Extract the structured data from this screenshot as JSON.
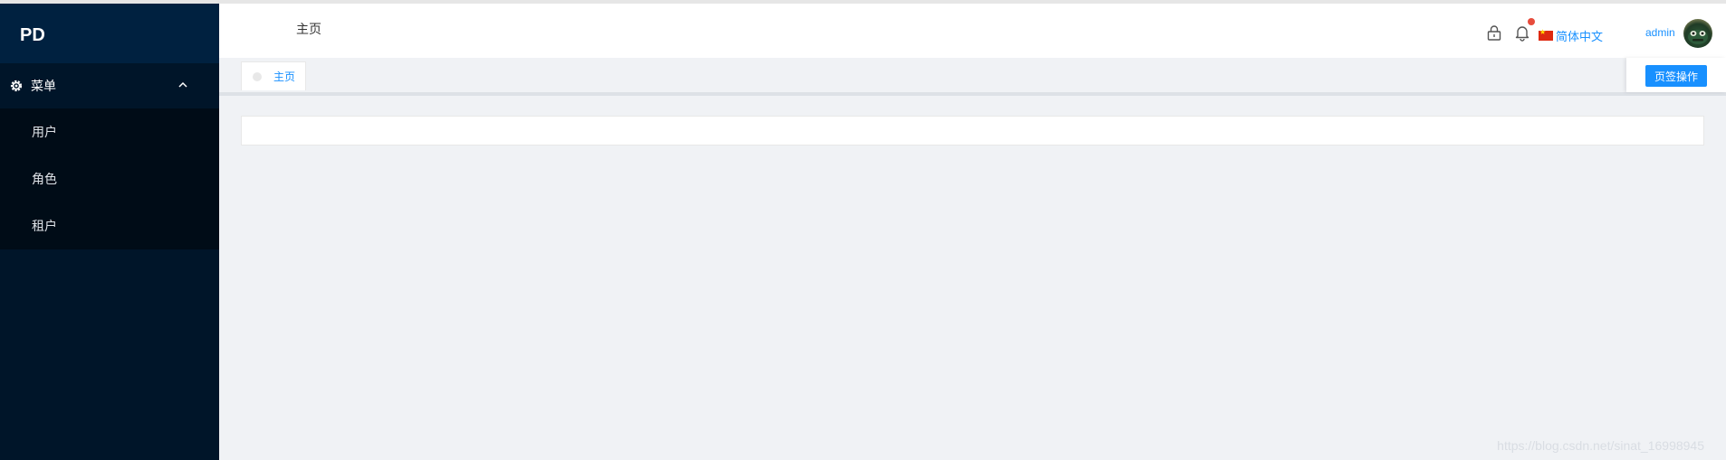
{
  "app": {
    "logo": "PD"
  },
  "sidebar": {
    "group": {
      "label": "菜单",
      "icon": "gear-icon",
      "expanded": true
    },
    "items": [
      {
        "label": "用户"
      },
      {
        "label": "角色"
      },
      {
        "label": "租户"
      }
    ]
  },
  "header": {
    "title": "主页",
    "language": "简体中文",
    "username": "admin",
    "has_notification": true
  },
  "tabs": {
    "items": [
      {
        "label": "主页",
        "active": true
      }
    ],
    "actions_label": "页签操作"
  },
  "watermark": "https://blog.csdn.net/sinat_16998945",
  "colors": {
    "sidebar_bg": "#001529",
    "submenu_bg": "#000c17",
    "accent": "#1890ff",
    "page_bg": "#f0f2f5",
    "notify": "#e74c3c"
  }
}
